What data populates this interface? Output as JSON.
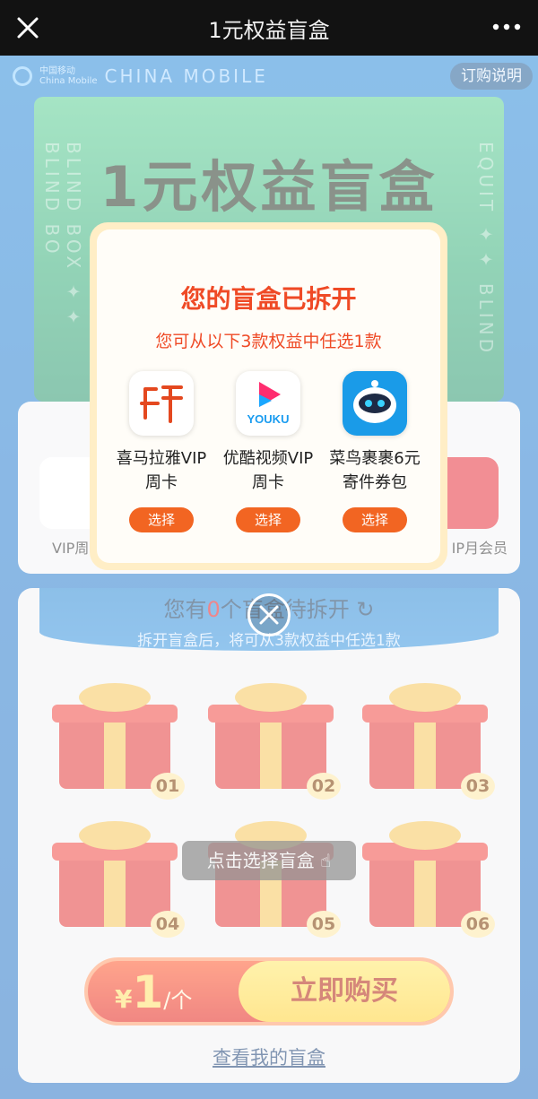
{
  "window": {
    "title": "1元权益盲盒"
  },
  "brand": {
    "cn": "中国移动",
    "en_small": "China Mobile",
    "en": "CHINA MOBILE"
  },
  "hero": {
    "subscribe_label": "订购说明",
    "title": "1元权益盲盒",
    "side_left": "BLIND BOX ✦✦ BLIND BO",
    "side_right": "EQUIT ✦✦ BLIND"
  },
  "rights_background": {
    "left_label": "VIP周",
    "right_label": "IP月会员"
  },
  "boxes": {
    "status_prefix": "您有",
    "count": "0",
    "status_suffix": "个盲盒待拆开",
    "hint": "拆开盲盒后，将可从3款权益中任选1款",
    "tap_hint": "点击选择盲盒",
    "items": [
      "01",
      "02",
      "03",
      "04",
      "05",
      "06"
    ]
  },
  "buy": {
    "currency": "¥",
    "price": "1",
    "unit": "/个",
    "button": "立即购买"
  },
  "my_boxes_link": "查看我的盲盒",
  "modal": {
    "title": "您的盲盒已拆开",
    "subtitle": "您可从以下3款权益中任选1款",
    "options": [
      {
        "name_line1": "喜马拉雅VIP",
        "name_line2": "周卡",
        "button": "选择",
        "icon": "ximalaya-icon"
      },
      {
        "name_line1": "优酷视频VIP",
        "name_line2": "周卡",
        "button": "选择",
        "icon": "youku-icon"
      },
      {
        "name_line1": "菜鸟裹裹6元",
        "name_line2": "寄件券包",
        "button": "选择",
        "icon": "cainiao-icon"
      }
    ],
    "youku_text": "YOUKU"
  },
  "colors": {
    "accent": "#ef4a26",
    "button": "#f26522",
    "page_bg": "#2d8bd9"
  }
}
